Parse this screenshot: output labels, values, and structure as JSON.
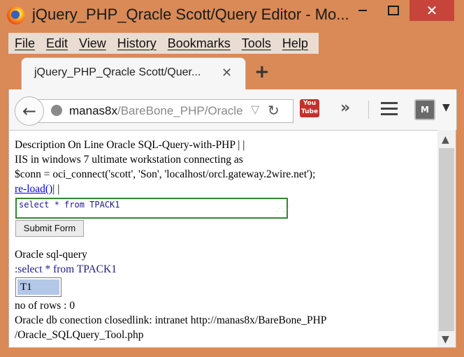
{
  "window": {
    "title": "jQuery_PHP_Qracle Scott/Query Editor - Mo...",
    "close_glyph": "✕"
  },
  "menu": [
    {
      "label": "File"
    },
    {
      "label": "Edit"
    },
    {
      "label": "View"
    },
    {
      "label": "History"
    },
    {
      "label": "Bookmarks"
    },
    {
      "label": "Tools"
    },
    {
      "label": "Help"
    }
  ],
  "tab": {
    "title": "jQuery_PHP_Qracle Scott/Quer...",
    "close_glyph": "✕",
    "new_tab_glyph": "+"
  },
  "navbar": {
    "url_host": "manas8x",
    "url_path": "/BareBone_PHP/Oracle",
    "youtube_label": "You Tube",
    "overflow_glyph": "»",
    "shield_label": "M"
  },
  "content": {
    "line1": "Description On Line Oracle SQL-Query-with-PHP | |",
    "line2": "IIS in windows 7 ultimate workstation connecting as",
    "line3": "$conn = oci_connect('scott', 'Son', 'localhost/orcl.gateway.2wire.net');",
    "reload_link": "re-load()",
    "reload_suffix": "| |",
    "query_value": "select * from TPACK1",
    "submit_label": "Submit Form",
    "result_title": "Oracle sql-query",
    "result_query": ":select * from TPACK1",
    "cell_value": "T1",
    "rows_text": "no of rows : 0",
    "closed_line1": "Oracle db conection closedlink: intranet http://manas8x/BareBone_PHP",
    "closed_line2": "/Oracle_SQLQuery_Tool.php"
  },
  "colors": {
    "frame": "#d98a56",
    "close_button": "#c7443b",
    "input_border": "#2f8a2f",
    "link": "#0000ee",
    "query_text": "#1d1a8a",
    "cell_highlight": "#b3c7e8"
  }
}
